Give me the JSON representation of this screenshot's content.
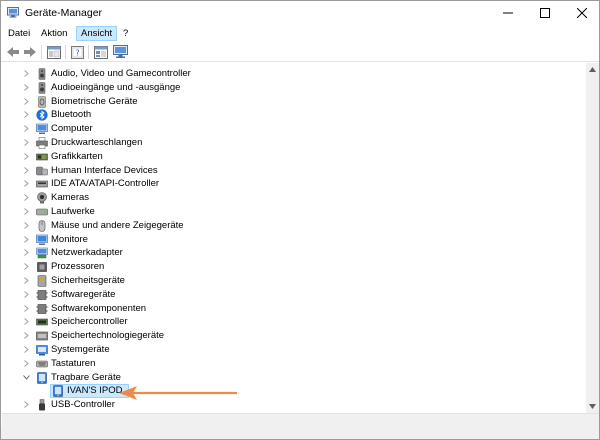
{
  "window": {
    "title": "Geräte-Manager"
  },
  "menu": {
    "items": [
      "Datei",
      "Aktion",
      "Ansicht",
      "?"
    ],
    "active_index": 2
  },
  "toolbar": {
    "buttons": [
      "back-arrow-icon",
      "forward-arrow-icon",
      "properties-panel-icon",
      "help-icon",
      "view-list-icon",
      "monitor-scan-icon"
    ]
  },
  "tree": {
    "items": [
      {
        "label": "Audio, Video und Gamecontroller",
        "icon": "speaker-icon",
        "expanded": false
      },
      {
        "label": "Audioeingänge und -ausgänge",
        "icon": "speaker-icon",
        "expanded": false
      },
      {
        "label": "Biometrische Geräte",
        "icon": "fingerprint-icon",
        "expanded": false
      },
      {
        "label": "Bluetooth",
        "icon": "bluetooth-icon",
        "expanded": false
      },
      {
        "label": "Computer",
        "icon": "computer-icon",
        "expanded": false
      },
      {
        "label": "Druckwarteschlangen",
        "icon": "printer-icon",
        "expanded": false
      },
      {
        "label": "Grafikkarten",
        "icon": "display-adapter-icon",
        "expanded": false
      },
      {
        "label": "Human Interface Devices",
        "icon": "hid-icon",
        "expanded": false
      },
      {
        "label": "IDE ATA/ATAPI-Controller",
        "icon": "ide-icon",
        "expanded": false
      },
      {
        "label": "Kameras",
        "icon": "camera-icon",
        "expanded": false
      },
      {
        "label": "Laufwerke",
        "icon": "drive-icon",
        "expanded": false
      },
      {
        "label": "Mäuse und andere Zeigegeräte",
        "icon": "mouse-icon",
        "expanded": false
      },
      {
        "label": "Monitore",
        "icon": "monitor-icon",
        "expanded": false
      },
      {
        "label": "Netzwerkadapter",
        "icon": "network-icon",
        "expanded": false
      },
      {
        "label": "Prozessoren",
        "icon": "cpu-icon",
        "expanded": false
      },
      {
        "label": "Sicherheitsgeräte",
        "icon": "security-icon",
        "expanded": false
      },
      {
        "label": "Softwaregeräte",
        "icon": "software-icon",
        "expanded": false
      },
      {
        "label": "Softwarekomponenten",
        "icon": "software-icon",
        "expanded": false
      },
      {
        "label": "Speichercontroller",
        "icon": "storage-controller-icon",
        "expanded": false
      },
      {
        "label": "Speichertechnologiegeräte",
        "icon": "storage-tech-icon",
        "expanded": false
      },
      {
        "label": "Systemgeräte",
        "icon": "system-icon",
        "expanded": false
      },
      {
        "label": "Tastaturen",
        "icon": "keyboard-icon",
        "expanded": false
      },
      {
        "label": "Tragbare Geräte",
        "icon": "portable-device-icon",
        "expanded": true
      },
      {
        "label": "IVAN'S IPOD",
        "icon": "portable-device-icon",
        "child": true,
        "selected": true
      },
      {
        "label": "USB-Controller",
        "icon": "usb-icon",
        "expanded": false
      }
    ]
  },
  "colors": {
    "selection_bg": "#cce8ff",
    "selection_border": "#99d1ff",
    "arrow": "#f08a4b"
  }
}
